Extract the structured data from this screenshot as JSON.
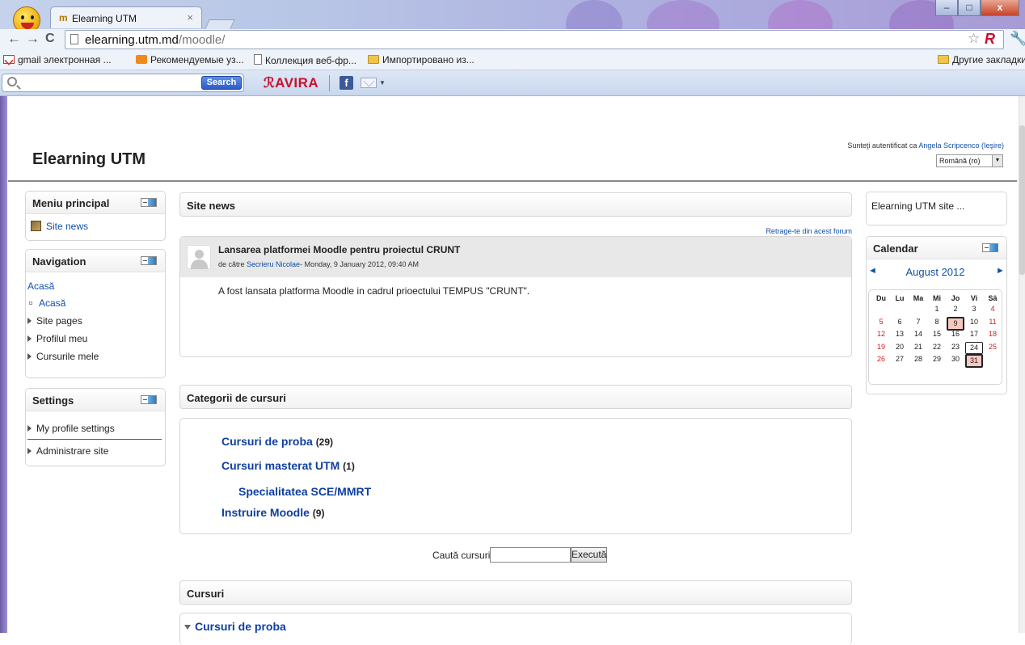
{
  "browser": {
    "tab_title": "Elearning UTM",
    "tab_close": "×",
    "url_host": "elearning.utm.md",
    "url_path": "/moodle/",
    "bookmarks": [
      {
        "label": "gmail электронная ...",
        "icon": "gmail-icon"
      },
      {
        "label": "Рекомендуемые уз...",
        "icon": "recommended-icon"
      },
      {
        "label": "Коллекция веб-фр...",
        "icon": "page-icon"
      },
      {
        "label": "Импортировано из...",
        "icon": "folder-icon"
      }
    ],
    "other_bookmarks": "Другие закладки",
    "toolbar_search_button": "Search",
    "avira_label": "AVIRA",
    "facebook_label": "f",
    "window_min": "–",
    "window_max": "□",
    "window_close": "x"
  },
  "header": {
    "site_title": "Elearning UTM",
    "logged_in_prefix": "Sunteţi autentificat ca ",
    "user_name": "Angela Scripcenco",
    "logout_label": "(Ieşire)",
    "language": "Română (ro)"
  },
  "left": {
    "main_menu": {
      "title": "Meniu principal",
      "items": [
        "Site news"
      ]
    },
    "navigation": {
      "title": "Navigation",
      "home": "Acasă",
      "items": [
        "Acasă",
        "Site pages",
        "Profilul meu",
        "Cursurile mele"
      ]
    },
    "settings": {
      "title": "Settings",
      "items": [
        "My profile settings",
        "Administrare site"
      ]
    }
  },
  "center": {
    "site_news_title": "Site news",
    "unsubscribe": "Retrage-te din acest forum",
    "post": {
      "subject": "Lansarea platformei Moodle pentru proiectul CRUNT",
      "by": "de către ",
      "author": "Secrieru Nicolae",
      "date": "- Monday, 9 January 2012, 09:40 AM",
      "body": "A fost lansata platforma Moodle in cadrul prioectului TEMPUS \"CRUNT\"."
    },
    "categories_title": "Categorii de cursuri",
    "categories": [
      {
        "name": "Cursuri de proba",
        "count": "(29)"
      },
      {
        "name": "Cursuri masterat UTM",
        "count": "(1)"
      },
      {
        "name": "Specialitatea SCE/MMRT",
        "count": ""
      },
      {
        "name": "Instruire Moodle",
        "count": "(9)"
      }
    ],
    "search_label": "Caută cursuri:",
    "search_button": "Execută",
    "courses_title": "Cursuri",
    "courses_first": "Cursuri de proba"
  },
  "right": {
    "site_block_text": "Elearning UTM site ...",
    "calendar": {
      "title": "Calendar",
      "month": "August 2012",
      "prev": "◄",
      "next": "►",
      "weekdays": [
        "Du",
        "Lu",
        "Ma",
        "Mi",
        "Jo",
        "Vi",
        "Sâ"
      ],
      "weeks": [
        [
          "",
          "",
          "",
          "1",
          "2",
          "3",
          "4"
        ],
        [
          "5",
          "6",
          "7",
          "8",
          "9",
          "10",
          "11"
        ],
        [
          "12",
          "13",
          "14",
          "15",
          "16",
          "17",
          "18"
        ],
        [
          "19",
          "20",
          "21",
          "22",
          "23",
          "24",
          "25"
        ],
        [
          "26",
          "27",
          "28",
          "29",
          "30",
          "31",
          ""
        ]
      ],
      "today": "31",
      "highlighted": [
        "9",
        "24"
      ]
    }
  }
}
